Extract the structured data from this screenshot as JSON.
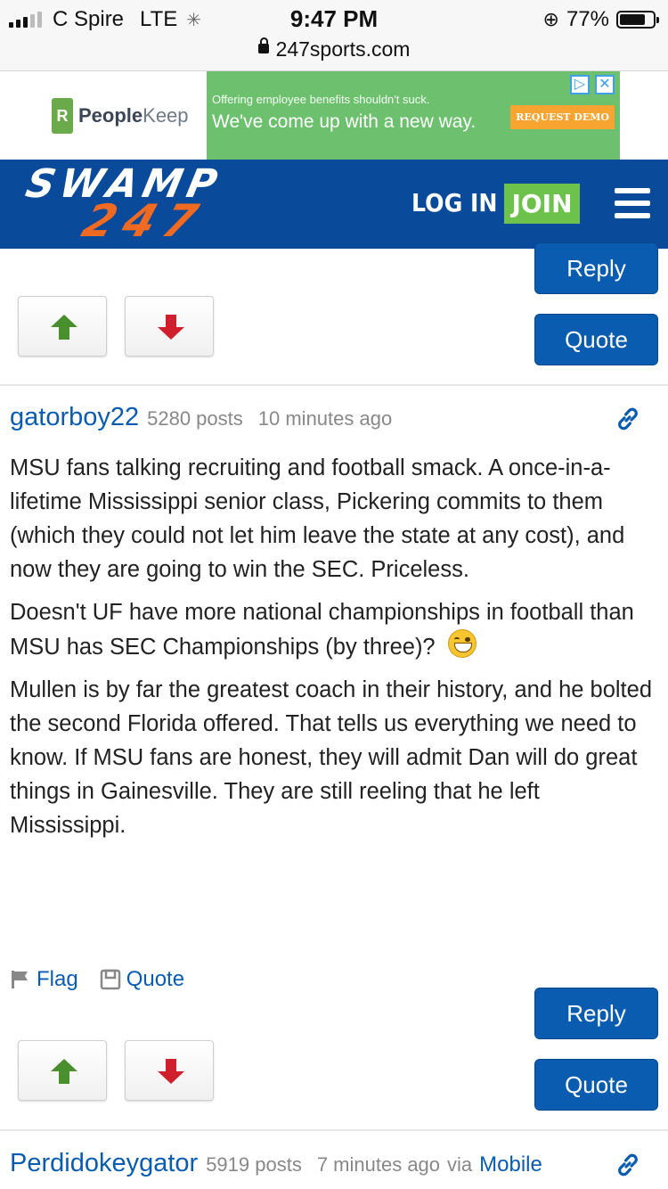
{
  "status_bar": {
    "carrier": "C Spire",
    "network": "LTE",
    "time": "9:47 PM",
    "battery": "77%",
    "battery_level": 0.77,
    "url": "247sports.com"
  },
  "ad": {
    "brand_people": "People",
    "brand_keep": "Keep",
    "line1": "Offering employee benefits shouldn't suck.",
    "line2": "We've come up with a new way.",
    "cta": "REQUEST DEMO"
  },
  "header": {
    "logo_top": "SWAMP",
    "logo_bottom": "247",
    "login_label": "LOG IN",
    "join_label": "JOIN"
  },
  "post_controls": {
    "reply_label": "Reply",
    "quote_label": "Quote"
  },
  "posts": [
    {
      "username": "gatorboy22",
      "post_count": "5280 posts",
      "time": "10 minutes ago",
      "paragraphs": [
        "MSU fans talking recruiting and football smack. A once-in-a-lifetime Mississippi senior class, Pickering commits to them (which they could not let him leave the state at any cost), and now they are going to win the SEC. Priceless.",
        "Doesn't UF have more national championships in football than MSU has SEC Championships (by three)?",
        "Mullen is by far the greatest coach in their history, and he bolted the second Florida offered. That tells us everything we need to know. If MSU fans are honest, they will admit Dan will do great things in Gainesville. They are still reeling that he left Mississippi."
      ],
      "emoji": "laughing-emoji",
      "flag_label": "Flag",
      "quote_label": "Quote"
    },
    {
      "username": "Perdidokeygator",
      "post_count": "5919 posts",
      "time": "7 minutes ago",
      "via": "via",
      "source": "Mobile"
    }
  ],
  "colors": {
    "header_blue": "#0a4a9a",
    "button_blue": "#0a5cb0",
    "join_green": "#6cc24a",
    "logo_orange": "#f06a22",
    "upvote_green": "#4a8f2e",
    "downvote_red": "#d0202e"
  }
}
